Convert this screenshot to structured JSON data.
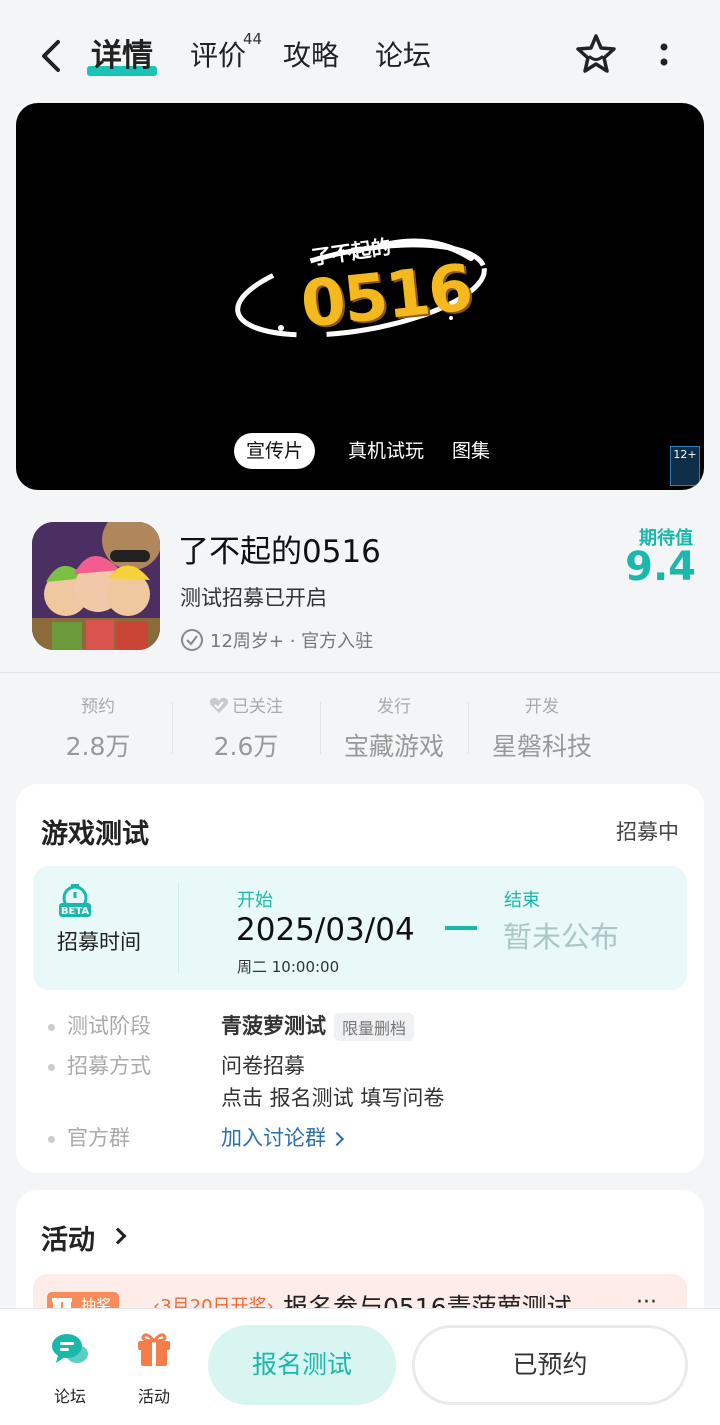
{
  "nav": {
    "tabs": [
      {
        "label": "详情"
      },
      {
        "label": "评价"
      },
      {
        "label": "攻略"
      },
      {
        "label": "论坛"
      }
    ],
    "review_count": "44"
  },
  "video": {
    "logo_small": "了不起的",
    "logo_big": "0516",
    "media_tabs": [
      "宣传片",
      "真机试玩",
      "图集"
    ],
    "age_rating": "12+"
  },
  "game": {
    "title": "了不起的0516",
    "subtitle": "测试招募已开启",
    "meta": "12周岁+ · 官方入驻",
    "expectation_label": "期待值",
    "expectation_value": "9.4"
  },
  "stats": [
    {
      "label": "预约",
      "value": "2.8万"
    },
    {
      "label": "已关注",
      "value": "2.6万"
    },
    {
      "label": "发行",
      "value": "宝藏游戏"
    },
    {
      "label": "开发",
      "value": "星磐科技"
    }
  ],
  "test": {
    "title": "游戏测试",
    "status": "招募中",
    "beta_text": "BETA",
    "recruit_label": "招募时间",
    "start_label": "开始",
    "start_date": "2025/03/04",
    "start_time": "周二  10:00:00",
    "end_label": "结束",
    "end_value": "暂未公布",
    "phase_label": "测试阶段",
    "phase_value": "青菠萝测试",
    "phase_tag": "限量删档",
    "method_label": "招募方式",
    "method_value": "问卷招募",
    "method_hint": "点击 报名测试 填写问卷",
    "group_label": "官方群",
    "group_link": "加入讨论群"
  },
  "activity": {
    "title": "活动",
    "item_tag": "抽奖",
    "item_date": "‹3月20日开奖›",
    "item_text": "报名参与0516青菠萝测试",
    "item_more": "···"
  },
  "bottom": {
    "forum_label": "论坛",
    "activity_label": "活动",
    "signup_label": "报名测试",
    "reserved_label": "已预约"
  },
  "colors": {
    "accent": "#19b8ab",
    "link": "#2b6fae",
    "activity_orange": "#f78b5a"
  }
}
